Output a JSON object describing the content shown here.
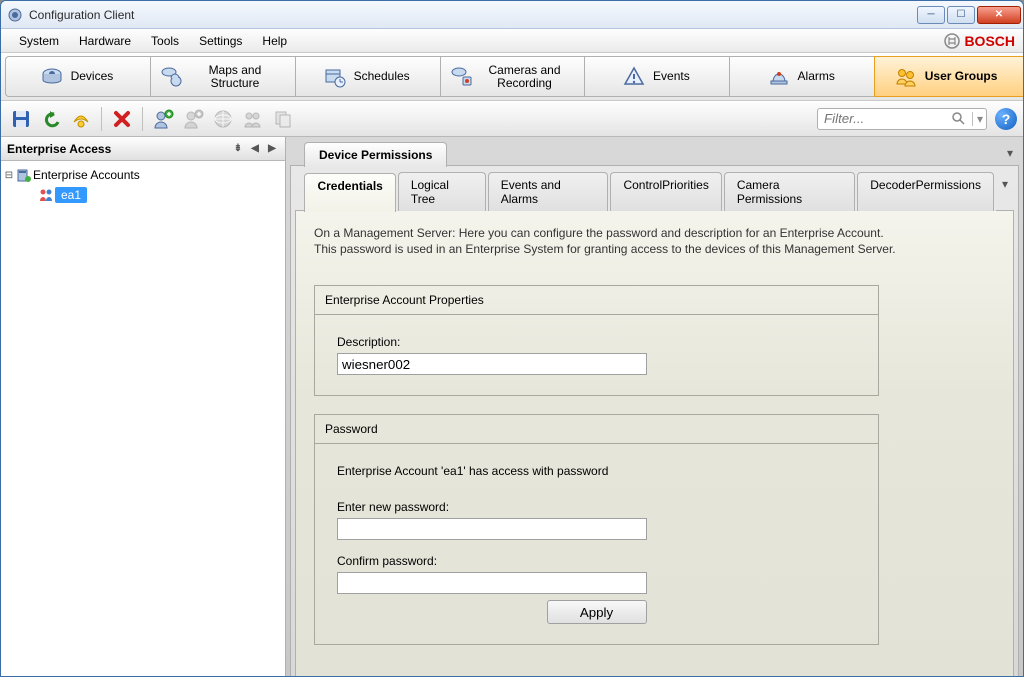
{
  "window": {
    "title": "Configuration Client"
  },
  "menu": {
    "system": "System",
    "hardware": "Hardware",
    "tools": "Tools",
    "settings": "Settings",
    "help": "Help",
    "brand": "BOSCH"
  },
  "nav": {
    "devices": "Devices",
    "maps": "Maps and Structure",
    "schedules": "Schedules",
    "cameras": "Cameras and Recording",
    "events": "Events",
    "alarms": "Alarms",
    "usergroups": "User Groups"
  },
  "toolbar": {
    "filter_placeholder": "Filter..."
  },
  "sidebar": {
    "header": "Enterprise Access",
    "root": "Enterprise Accounts",
    "child": "ea1"
  },
  "outer_tab": "Device Permissions",
  "inner_tabs": {
    "credentials": "Credentials",
    "logical_tree": "Logical Tree",
    "events_alarms": "Events and Alarms",
    "control_priorities": "ControlPriorities",
    "camera_permissions": "Camera Permissions",
    "decoder_permissions": "DecoderPermissions"
  },
  "content": {
    "info_line1": "On a Management Server: Here you can configure the password and description for an Enterprise Account.",
    "info_line2": "This password is used in an Enterprise System for granting access to the devices of this Management Server.",
    "props_title": "Enterprise Account Properties",
    "description_label": "Description:",
    "description_value": "wiesner002",
    "password_title": "Password",
    "password_status": "Enterprise Account 'ea1' has access with password",
    "enter_pw_label": "Enter new password:",
    "confirm_pw_label": "Confirm password:",
    "apply": "Apply"
  }
}
